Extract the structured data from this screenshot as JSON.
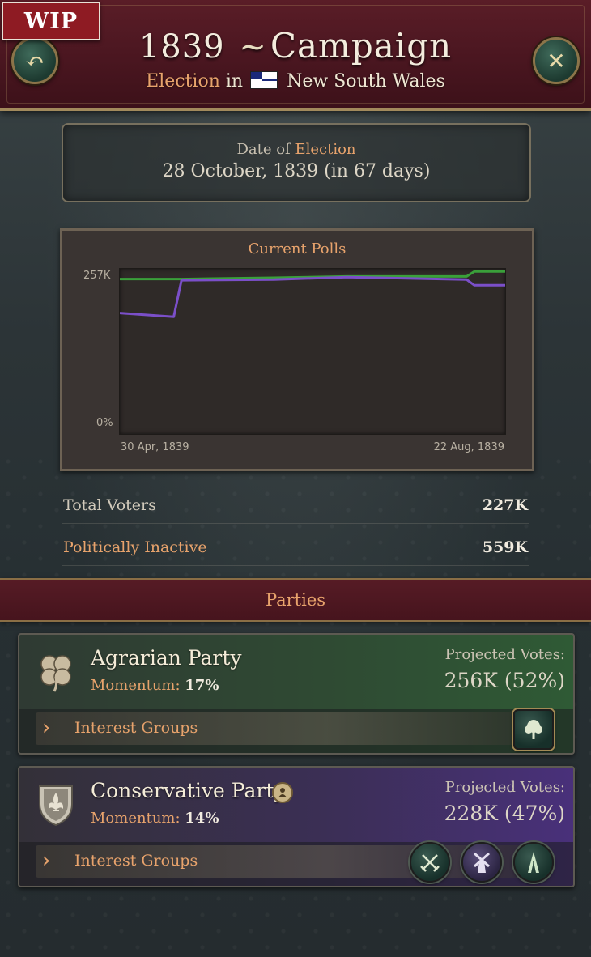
{
  "badge": "WIP",
  "header": {
    "title_year": "1839",
    "title_swash": "~",
    "title_word": "Campaign",
    "subtitle_prefix": "Election",
    "subtitle_in": "in",
    "subtitle_region": "New South Wales"
  },
  "date": {
    "label_prefix": "Date of",
    "label_accent": "Election",
    "value": "28 October, 1839 (in 67 days)"
  },
  "polls": {
    "title": "Current Polls"
  },
  "chart_data": {
    "type": "line",
    "title": "Current Polls",
    "y_tick_labels": [
      "257K",
      "0%"
    ],
    "x_tick_labels": [
      "30 Apr, 1839",
      "22 Aug, 1839"
    ],
    "ylim": [
      0,
      257
    ],
    "grid": false,
    "x": [
      0,
      14,
      16,
      40,
      59,
      90,
      92,
      100
    ],
    "series": [
      {
        "color": "#3aa03a",
        "values": [
          246,
          246,
          246,
          248,
          250,
          250,
          258,
          258
        ]
      },
      {
        "color": "#7b4fc9",
        "values": [
          192,
          186,
          244,
          245,
          249,
          245,
          236,
          236
        ]
      }
    ]
  },
  "stats": {
    "total_voters_label": "Total Voters",
    "total_voters_value": "227K",
    "inactive_label": "Politically Inactive",
    "inactive_value": "559K"
  },
  "parties_title": "Parties",
  "parties": [
    {
      "name": "Agrarian Party",
      "momentum_label": "Momentum:",
      "momentum_value": "17%",
      "projected_label": "Projected Votes:",
      "projected_value": "256K (52%)",
      "interest_groups_label": "Interest Groups",
      "emblem_icon": "clover-icon",
      "interest_group_icons": [
        "tree-icon"
      ]
    },
    {
      "name": "Conservative Party",
      "momentum_label": "Momentum:",
      "momentum_value": "14%",
      "projected_label": "Projected Votes:",
      "projected_value": "228K (47%)",
      "interest_groups_label": "Interest Groups",
      "emblem_icon": "fleur-de-lis-shield-icon",
      "interest_group_icons": [
        "crossed-swords-icon",
        "windmill-icon",
        "spire-icon"
      ]
    }
  ],
  "colors": {
    "accent_orange": "#e8a36c",
    "banner_red": "#4a1620",
    "agrarian_green": "#3aa03a",
    "conservative_purple": "#7b4fc9"
  }
}
